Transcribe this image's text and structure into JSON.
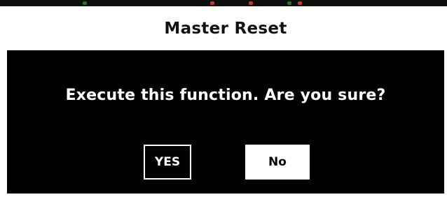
{
  "dialog": {
    "title": "Master Reset",
    "message": "Execute this function. Are you sure?",
    "yes_label": "YES",
    "no_label": "No"
  },
  "colors": {
    "title_background": "#ffffff",
    "body_background": "#000000",
    "text_primary": "#ffffff",
    "title_text": "#111111"
  }
}
